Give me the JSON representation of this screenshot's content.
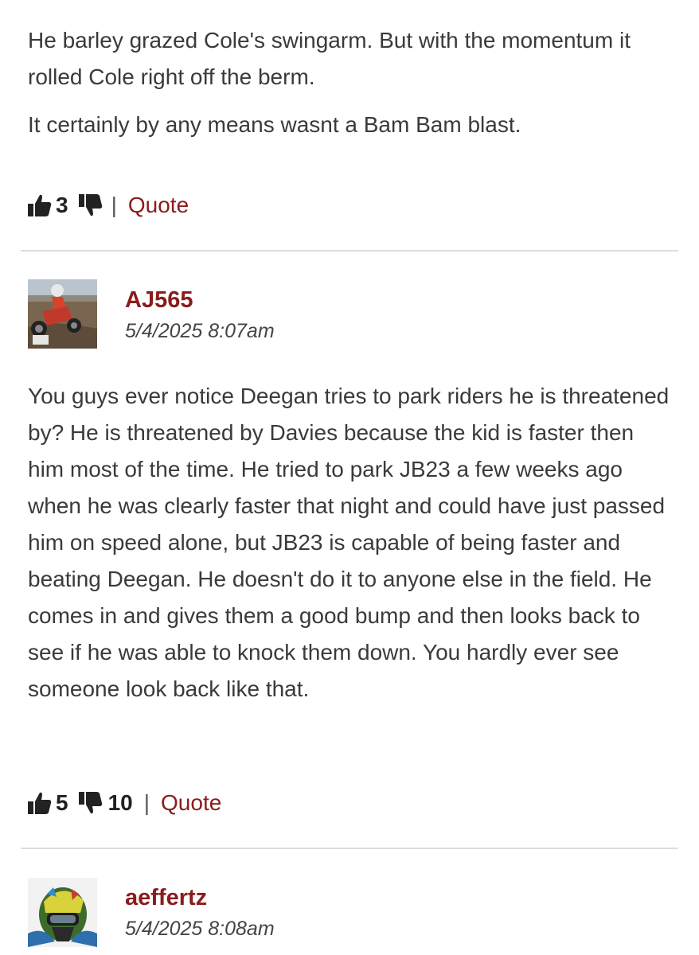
{
  "post1": {
    "paragraphs": [
      "He barley grazed Cole's swingarm. But with the momentum it rolled Cole right off the berm.",
      "It certainly by any means wasnt a Bam Bam blast."
    ],
    "upvotes": "3",
    "downvotes": "",
    "separator": "|",
    "quote_label": "Quote"
  },
  "post2": {
    "username": "AJ565",
    "date": "5/4/2025 8:07am",
    "body": "You guys ever notice Deegan tries to park riders he is threatened by? He is threatened by Davies because the kid is faster then him most of the time. He tried to park JB23 a few weeks ago when he was clearly faster that night and could have just passed him on speed alone, but JB23 is capable of being faster and beating Deegan. He doesn't do it to anyone else in the field. He comes in and gives them a good bump and then looks back to see if he was able to knock them down. You hardly ever see someone look back like that.",
    "upvotes": "5",
    "downvotes": "10",
    "separator": "|",
    "quote_label": "Quote"
  },
  "post3": {
    "username": "aeffertz",
    "date": "5/4/2025 8:08am"
  },
  "colors": {
    "accent": "#8a1c1c",
    "text": "#3a3a3a",
    "divider": "#dddddd"
  },
  "icons": {
    "upvote": "thumbs-up-icon",
    "downvote": "thumbs-down-icon"
  }
}
